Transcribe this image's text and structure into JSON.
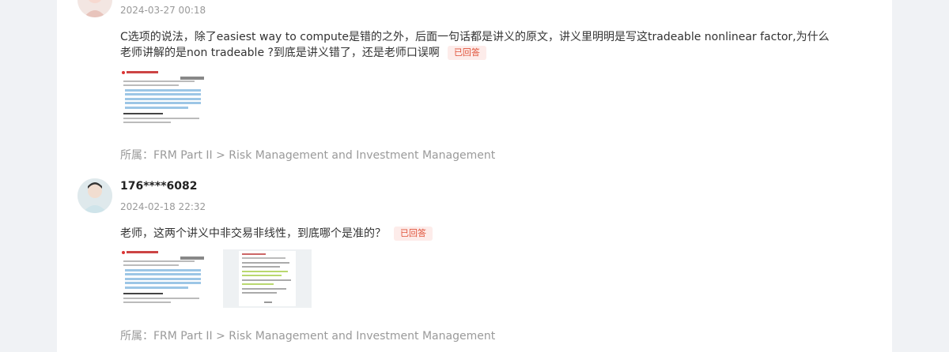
{
  "posts": [
    {
      "author": "",
      "time": "2024-03-27 00:18",
      "content": "C选项的说法，除了easiest way to compute是错的之外，后面一句话都是讲义的原文，讲义里明明是写这tradeable nonlinear factor,为什么老师讲解的是non tradeable ?到底是讲义错了，还是老师口误啊",
      "badge": "已回答",
      "category": "所属：FRM Part II > Risk Management and Investment Management",
      "thumbnails": [
        "lecture-slide-thumbnail"
      ]
    },
    {
      "author": "176****6082",
      "time": "2024-02-18 22:32",
      "content": "老师，这两个讲义中非交易非线性，到底哪个是准的？",
      "badge": "已回答",
      "category": "所属：FRM Part II > Risk Management and Investment Management",
      "thumbnails": [
        "lecture-slide-thumbnail",
        "lecture-notes-thumbnail"
      ]
    }
  ],
  "colors": {
    "page_bg": "#f0f2f5",
    "card_bg": "#ffffff",
    "badge_text": "#e0533b",
    "badge_bg": "#fdecea",
    "meta": "#999999"
  }
}
